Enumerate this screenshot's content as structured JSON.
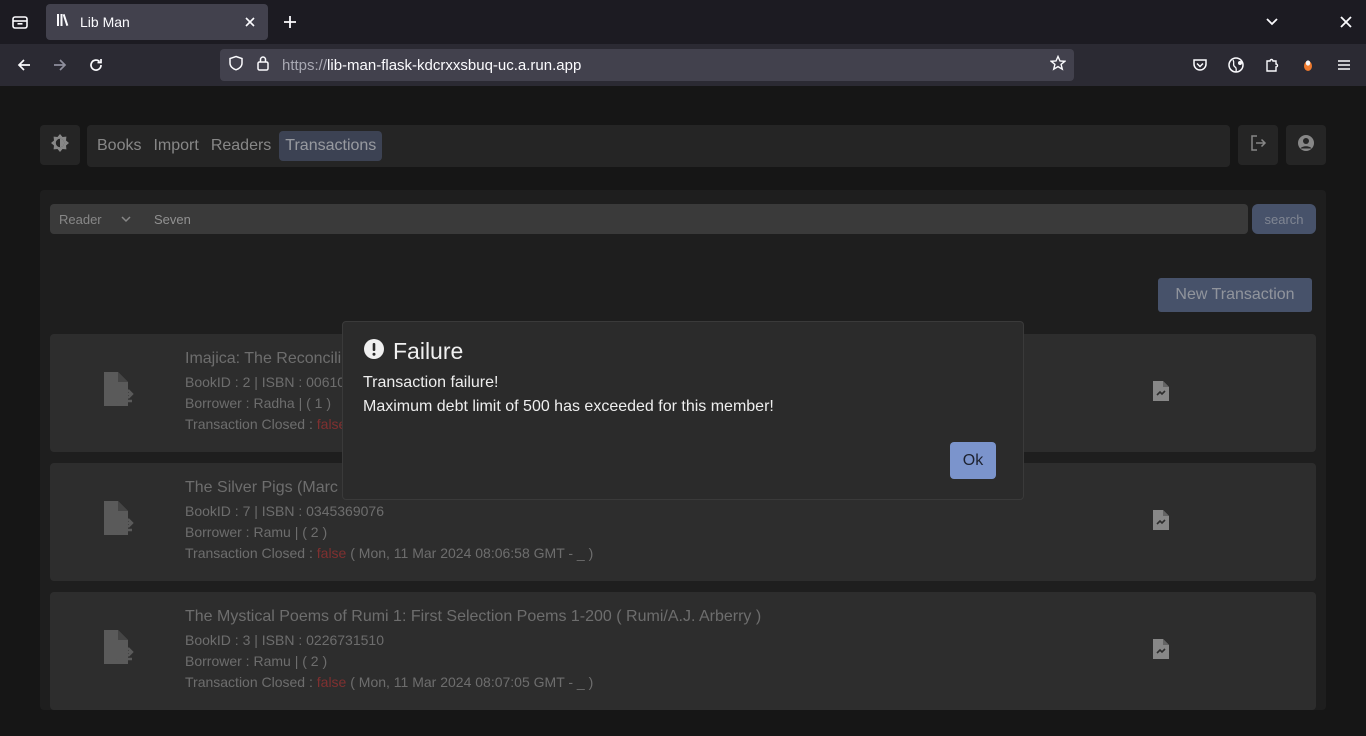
{
  "browser": {
    "tab_title": "Lib Man",
    "url_scheme": "https://",
    "url_host": "lib-man-flask-kdcrxxsbuq-uc.a.run.app"
  },
  "nav": {
    "items": [
      {
        "label": "Books",
        "active": false
      },
      {
        "label": "Import",
        "active": false
      },
      {
        "label": "Readers",
        "active": false
      },
      {
        "label": "Transactions",
        "active": true
      }
    ]
  },
  "search": {
    "filter_value": "Reader",
    "query": "Seven",
    "button_label": "search"
  },
  "new_transaction_label": "New Transaction",
  "transactions": [
    {
      "title": "Imajica: The Reconcili",
      "authors": "",
      "book_line": "BookID : 2 | ISBN : 00610",
      "borrower": "Borrower : Radha | ( 1 )",
      "closed_label": "Transaction Closed : ",
      "closed_value": "false",
      "closed_detail": ""
    },
    {
      "title": "The Silver Pigs (Marc",
      "authors": "",
      "book_line": "BookID : 7 | ISBN : 0345369076",
      "borrower": "Borrower : Ramu | ( 2 )",
      "closed_label": "Transaction Closed : ",
      "closed_value": "false",
      "closed_detail": " ( Mon, 11 Mar 2024 08:06:58 GMT - _ )"
    },
    {
      "title": "The Mystical Poems of Rumi 1: First Selection Poems 1-200 ",
      "authors": "( Rumi/A.J. Arberry )",
      "book_line": "BookID : 3 | ISBN : 0226731510",
      "borrower": "Borrower : Ramu | ( 2 )",
      "closed_label": "Transaction Closed : ",
      "closed_value": "false",
      "closed_detail": " ( Mon, 11 Mar 2024 08:07:05 GMT - _ )"
    }
  ],
  "modal": {
    "title": "Failure",
    "line1": "Transaction failure!",
    "line2": "Maximum debt limit of 500 has exceeded for this member!",
    "ok_label": "Ok"
  }
}
